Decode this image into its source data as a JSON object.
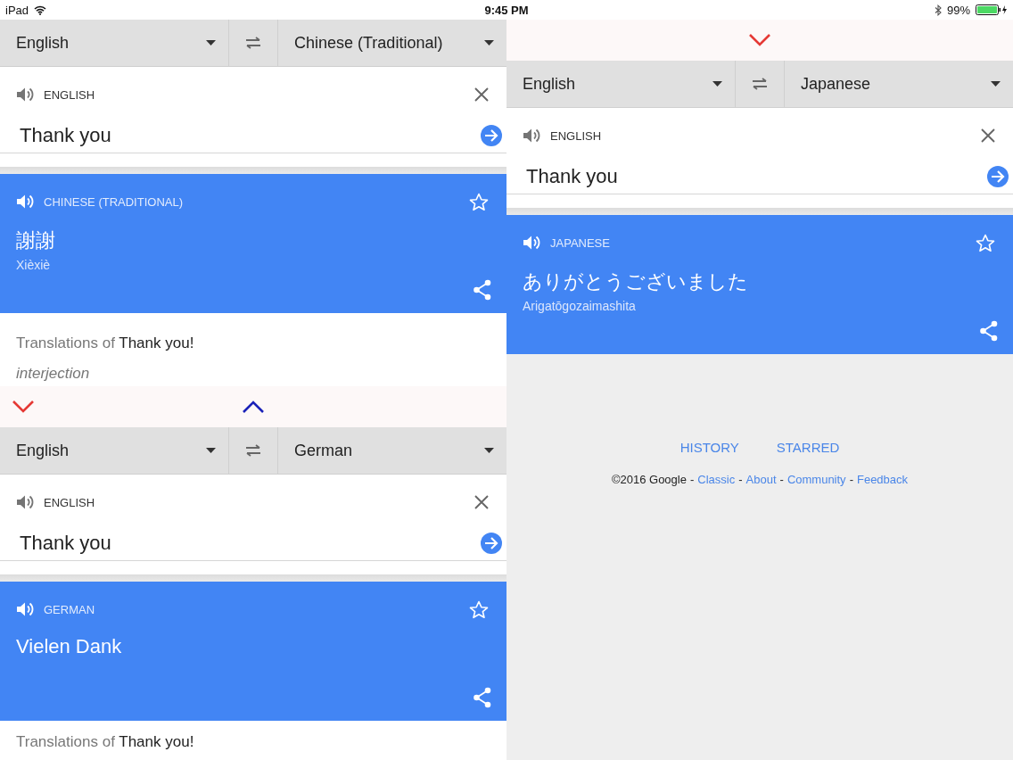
{
  "status_bar": {
    "device": "iPad",
    "time": "9:45 PM",
    "battery": "99%"
  },
  "columns": [
    {
      "items": [
        {
          "kind": "translator",
          "source_language": "English",
          "target_language": "Chinese (Traditional)",
          "input_label": "ENGLISH",
          "input_text": "Thank you",
          "output_label": "CHINESE (TRADITIONAL)",
          "translation": "謝謝",
          "romanization": "Xièxiè",
          "translations_of": "Translations of **Thank you!**",
          "part_of_speech": "interjection"
        },
        {
          "kind": "divider",
          "chevrons": [
            {
              "kind": "down",
              "color": "#e53935"
            },
            {
              "kind": "up",
              "color": "#1a22b8"
            }
          ]
        },
        {
          "kind": "translator",
          "source_language": "English",
          "target_language": "German",
          "input_label": "ENGLISH",
          "input_text": "Thank you",
          "output_label": "GERMAN",
          "translation": "Vielen Dank",
          "translations_of": "Translations of **Thank you!**"
        }
      ]
    },
    {
      "items": [
        {
          "kind": "divider",
          "chevrons": [
            {
              "kind": "down",
              "color": "#e53935"
            }
          ]
        },
        {
          "kind": "translator",
          "source_language": "English",
          "target_language": "Japanese",
          "input_label": "ENGLISH",
          "input_text": "Thank you",
          "output_label": "JAPANESE",
          "translation": "ありがとうございました",
          "romanization": "Arigatōgozaimashita"
        },
        {
          "kind": "footer",
          "tabs": [
            "HISTORY",
            "STARRED"
          ],
          "copyright": "©2016 Google",
          "separator": "-",
          "links": [
            "Classic",
            "About",
            "Community",
            "Feedback"
          ]
        }
      ]
    }
  ]
}
